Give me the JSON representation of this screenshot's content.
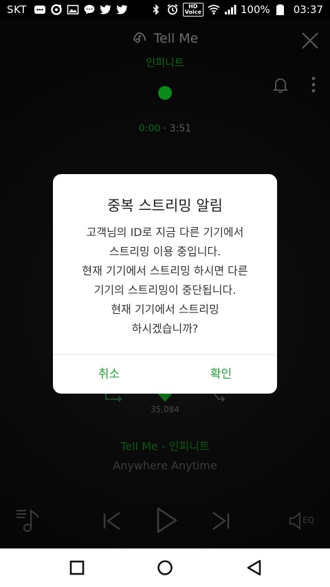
{
  "status_bar": {
    "carrier": "SKT",
    "hd_voice_line1": "HD",
    "hd_voice_line2": "Voice",
    "battery": "100%",
    "time": "03:37"
  },
  "player": {
    "song_title": "Tell Me",
    "artist": "인피니트",
    "current_time": "0:00",
    "separator": "·",
    "total_time": "3:51",
    "like_count": "35,084",
    "track_line": "Tell Me - 인피니트",
    "album": "Anywhere Anytime",
    "eq_label": "EQ"
  },
  "dialog": {
    "title": "중복 스트리밍 알림",
    "lines": [
      "고객님의 ID로 지금 다른 기기에서",
      "스트리밍 이용 중입니다.",
      "현재 기기에서 스트리밍 하시면 다른",
      "기기의 스트리밍이 중단됩니다.",
      "현재 기기에서 스트리밍",
      "하시겠습니까?"
    ],
    "cancel_label": "취소",
    "confirm_label": "확인"
  },
  "colors": {
    "accent": "#1aa52e",
    "dim_green": "#0b6b16"
  }
}
